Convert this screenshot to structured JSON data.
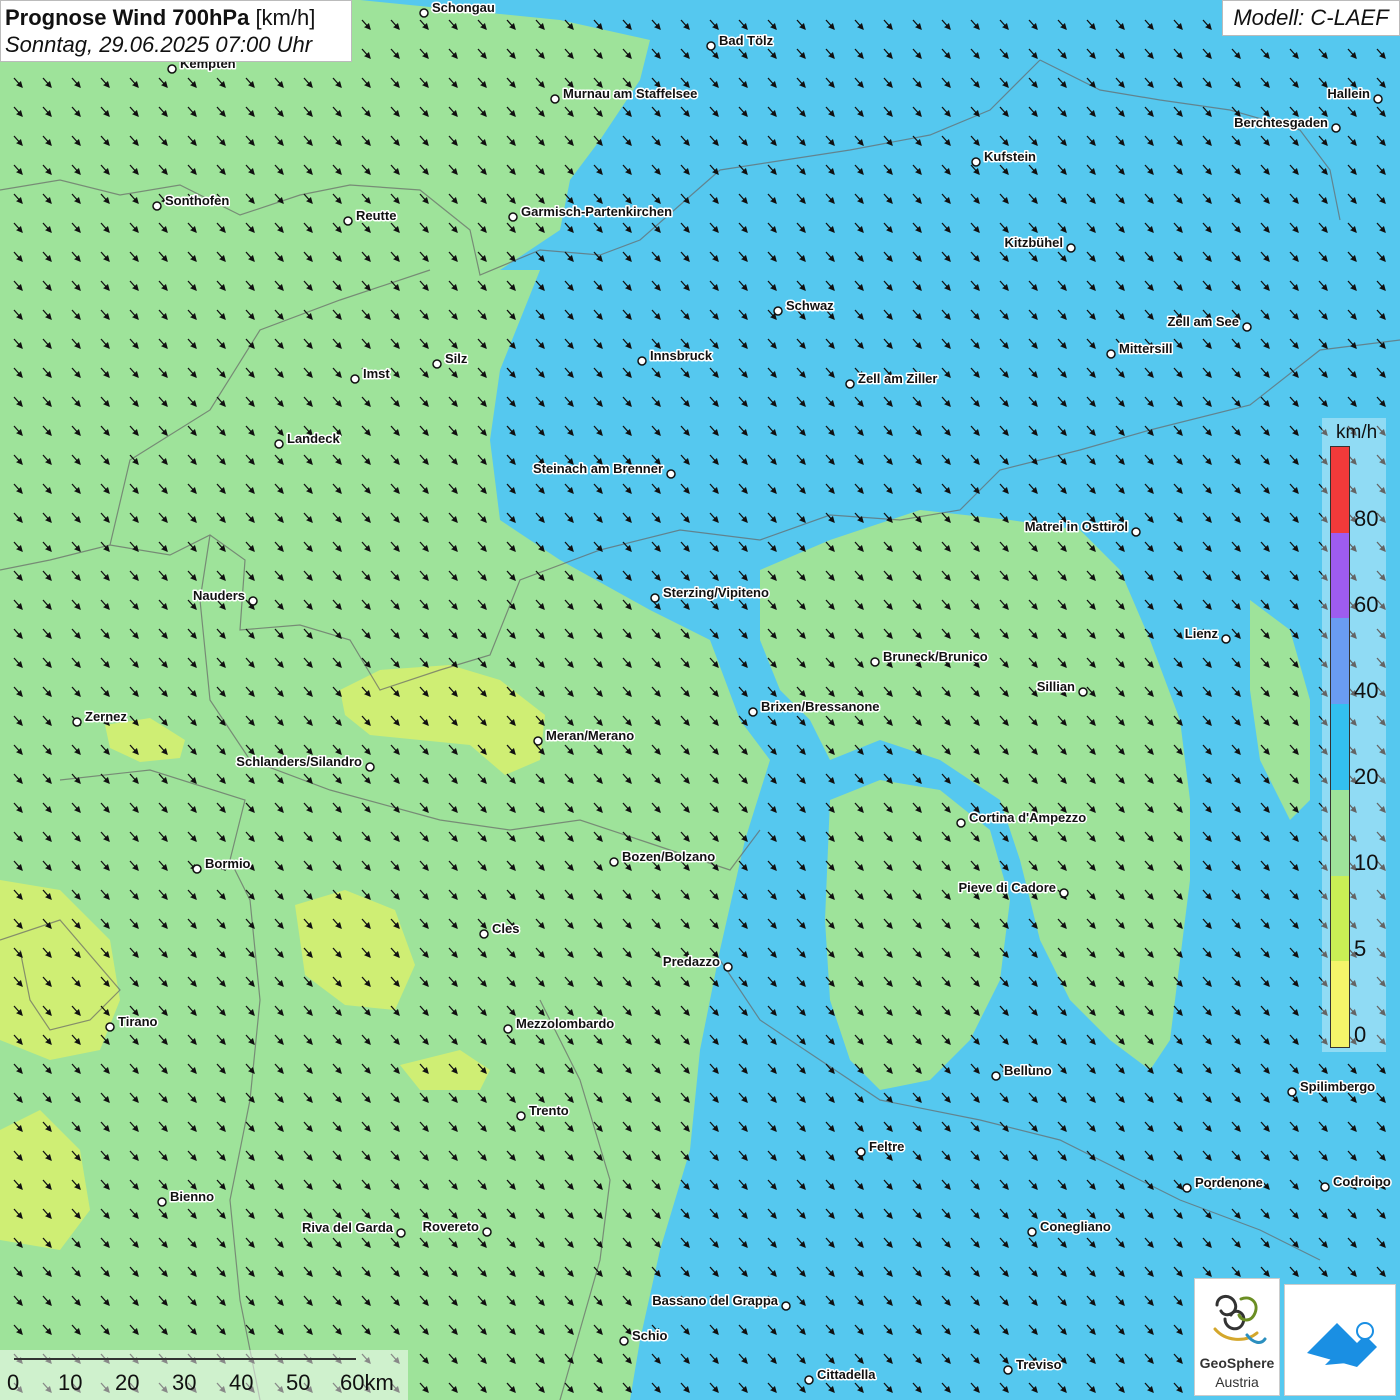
{
  "title": {
    "main": "Prognose Wind 700hPa",
    "unit": "[km/h]",
    "datetime": "Sonntag, 29.06.2025 07:00 Uhr"
  },
  "model": "Modell: C-LAEF",
  "legend": {
    "unit": "km/h",
    "labels": [
      "80",
      "60",
      "40",
      "20",
      "10",
      "5",
      "0"
    ],
    "colors": [
      "#f23a3a",
      "#9e5cf0",
      "#6a9cf3",
      "#33c0f0",
      "#9ee39a",
      "#c9ee55",
      "#f4f46a"
    ]
  },
  "colors": {
    "blue_zone": "#55c8ef",
    "green_zone": "#9ee39a",
    "yellow_zone": "#cfee74"
  },
  "scalebar": {
    "labels": [
      "0",
      "10",
      "20",
      "30",
      "40",
      "50",
      "60km"
    ]
  },
  "logos": {
    "geosphere_line1": "GeoSphere",
    "geosphere_line2": "Austria"
  },
  "cities": [
    {
      "name": "Schongau"
    },
    {
      "name": "Bad Tölz"
    },
    {
      "name": "Kempten"
    },
    {
      "name": "Murnau am Staffelsee"
    },
    {
      "name": "Hallein"
    },
    {
      "name": "Berchtesgaden"
    },
    {
      "name": "Kufstein"
    },
    {
      "name": "Sonthofen"
    },
    {
      "name": "Reutte"
    },
    {
      "name": "Garmisch-Partenkirchen"
    },
    {
      "name": "Kitzbühel"
    },
    {
      "name": "Schwaz"
    },
    {
      "name": "Zell am See"
    },
    {
      "name": "Mittersill"
    },
    {
      "name": "Innsbruck"
    },
    {
      "name": "Silz"
    },
    {
      "name": "Imst"
    },
    {
      "name": "Zell am Ziller"
    },
    {
      "name": "Landeck"
    },
    {
      "name": "Steinach am Brenner"
    },
    {
      "name": "Matrei in Osttirol"
    },
    {
      "name": "Nauders"
    },
    {
      "name": "Sterzing/Vipiteno"
    },
    {
      "name": "Lienz"
    },
    {
      "name": "Bruneck/Brunico"
    },
    {
      "name": "Sillian"
    },
    {
      "name": "Brixen/Bressanone"
    },
    {
      "name": "Zernez"
    },
    {
      "name": "Meran/Merano"
    },
    {
      "name": "Schlanders/Silandro"
    },
    {
      "name": "Cortina d'Ampezzo"
    },
    {
      "name": "Bormio"
    },
    {
      "name": "Bozen/Bolzano"
    },
    {
      "name": "Pieve di Cadore"
    },
    {
      "name": "Cles"
    },
    {
      "name": "Predazzo"
    },
    {
      "name": "Tirano"
    },
    {
      "name": "Mezzolombardo"
    },
    {
      "name": "Belluno"
    },
    {
      "name": "Spilimbergo"
    },
    {
      "name": "Trento"
    },
    {
      "name": "Feltre"
    },
    {
      "name": "Pordenone"
    },
    {
      "name": "Codroipo"
    },
    {
      "name": "Bienno"
    },
    {
      "name": "Riva del Garda"
    },
    {
      "name": "Rovereto"
    },
    {
      "name": "Conegliano"
    },
    {
      "name": "Bassano del Grappa"
    },
    {
      "name": "Schio"
    },
    {
      "name": "Treviso"
    },
    {
      "name": "Cittadella"
    }
  ]
}
